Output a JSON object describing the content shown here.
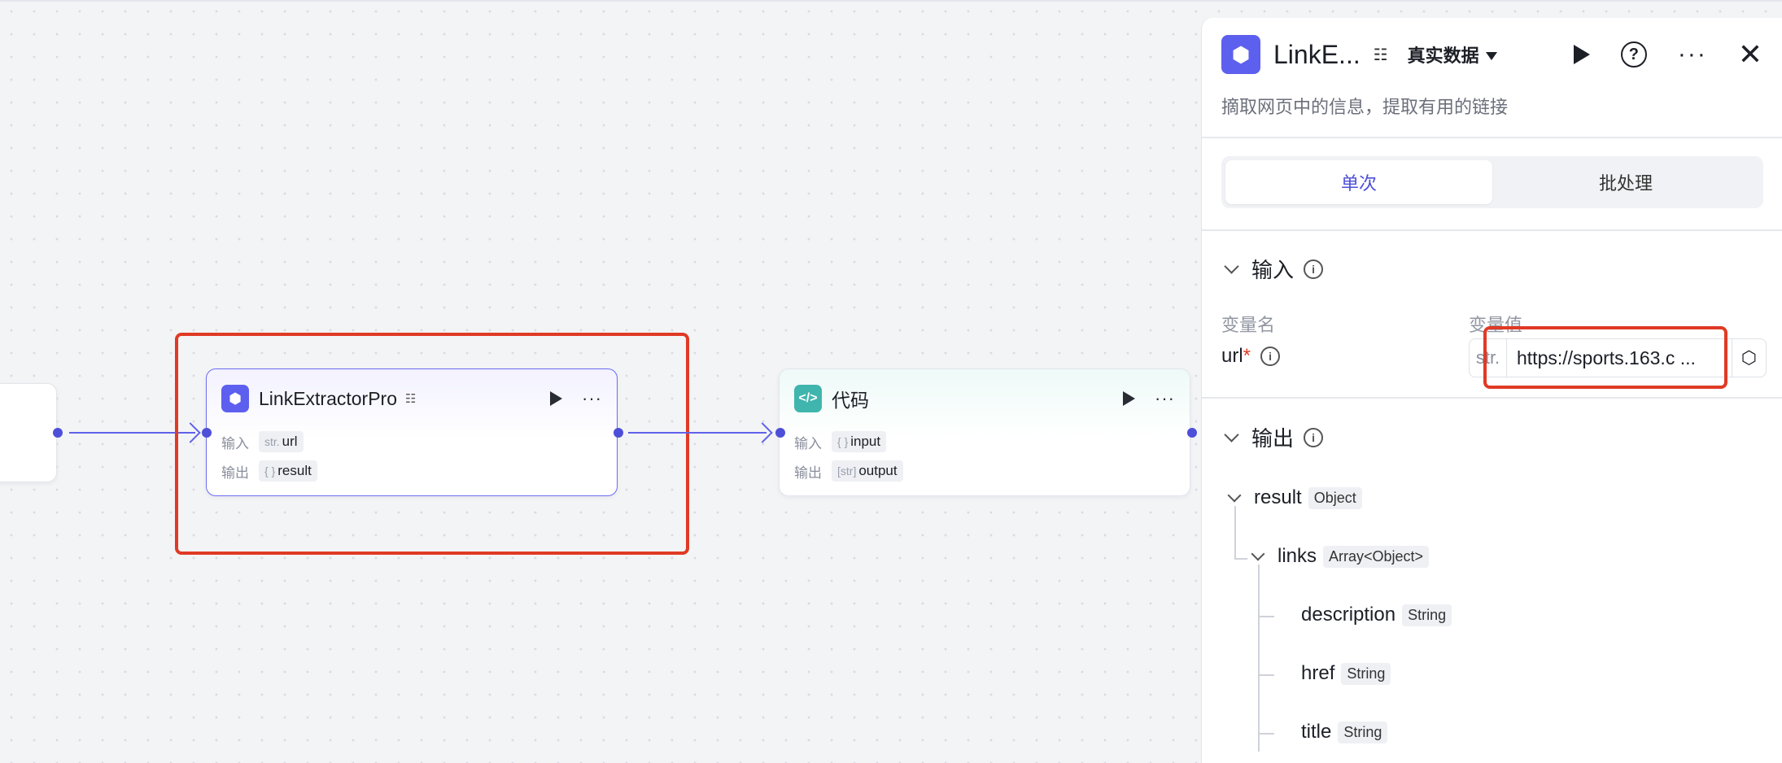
{
  "canvas": {
    "nodes": {
      "link": {
        "title": "LinkExtractorPro",
        "badge_icon": "data-link-icon",
        "input_label": "输入",
        "input_type": "str.",
        "input_name": "url",
        "output_label": "输出",
        "output_type": "{ }",
        "output_name": "result"
      },
      "code": {
        "title": "代码",
        "input_label": "输入",
        "input_type": "{ }",
        "input_name": "input",
        "output_label": "输出",
        "output_type": "[str]",
        "output_name": "output"
      }
    },
    "accent_color": "#5f61ea",
    "highlight_color": "#e03a25"
  },
  "panel": {
    "title": "LinkE...",
    "badge_icon": "data-link-icon",
    "data_mode": "真实数据",
    "description": "摘取网页中的信息，提取有用的链接",
    "tabs": [
      {
        "label": "单次",
        "active": true
      },
      {
        "label": "批处理",
        "active": false
      }
    ],
    "input_section": {
      "title": "输入",
      "col_name": "变量名",
      "col_value": "变量值",
      "var_name": "url",
      "required_mark": "*",
      "var_type": "str.",
      "var_value": "https://sports.163.c ..."
    },
    "output_section": {
      "title": "输出",
      "tree": [
        {
          "name": "result",
          "type": "Object"
        },
        {
          "name": "links",
          "type": "Array<Object>"
        },
        {
          "name": "description",
          "type": "String"
        },
        {
          "name": "href",
          "type": "String"
        },
        {
          "name": "title",
          "type": "String"
        }
      ]
    }
  }
}
